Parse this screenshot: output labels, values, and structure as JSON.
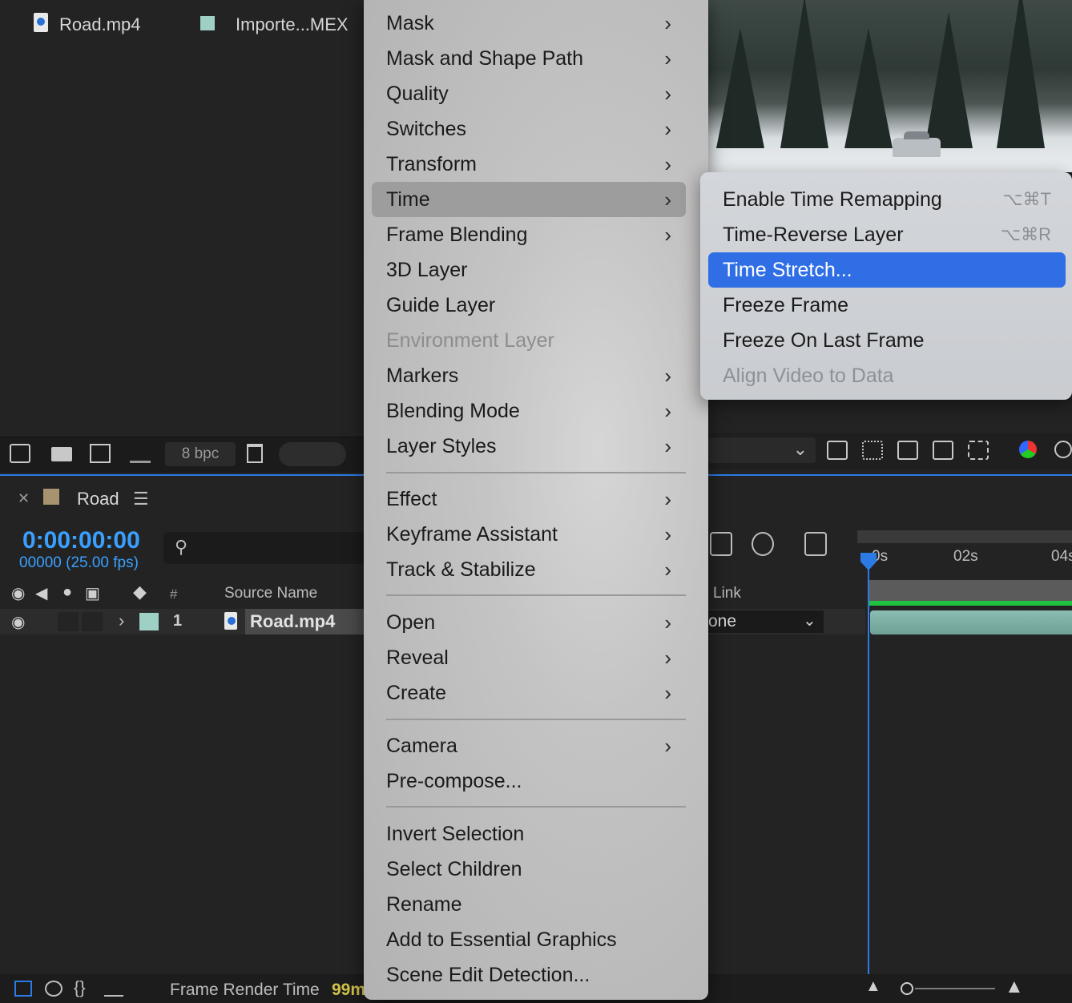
{
  "project": {
    "file_name": "Road.mp4",
    "file_type": "Importe...MEX",
    "bpc": "8 bpc",
    "label_color": "#9fd0c6"
  },
  "context_menu": {
    "items": [
      {
        "label": "Mask",
        "submenu": true
      },
      {
        "label": "Mask and Shape Path",
        "submenu": true
      },
      {
        "label": "Quality",
        "submenu": true
      },
      {
        "label": "Switches",
        "submenu": true
      },
      {
        "label": "Transform",
        "submenu": true
      },
      {
        "label": "Time",
        "submenu": true,
        "active": true
      },
      {
        "label": "Frame Blending",
        "submenu": true
      },
      {
        "label": "3D Layer",
        "submenu": false
      },
      {
        "label": "Guide Layer",
        "submenu": false
      },
      {
        "label": "Environment Layer",
        "submenu": false,
        "disabled": true
      },
      {
        "label": "Markers",
        "submenu": true
      },
      {
        "label": "Blending Mode",
        "submenu": true
      },
      {
        "label": "Layer Styles",
        "submenu": true
      },
      {
        "label": "Effect",
        "submenu": true
      },
      {
        "label": "Keyframe Assistant",
        "submenu": true
      },
      {
        "label": "Track & Stabilize",
        "submenu": true
      },
      {
        "label": "Open",
        "submenu": true
      },
      {
        "label": "Reveal",
        "submenu": true
      },
      {
        "label": "Create",
        "submenu": true
      },
      {
        "label": "Camera",
        "submenu": true
      },
      {
        "label": "Pre-compose...",
        "submenu": false
      },
      {
        "label": "Invert Selection",
        "submenu": false
      },
      {
        "label": "Select Children",
        "submenu": false
      },
      {
        "label": "Rename",
        "submenu": false
      },
      {
        "label": "Add to Essential Graphics",
        "submenu": false
      },
      {
        "label": "Scene Edit Detection...",
        "submenu": false
      }
    ]
  },
  "time_submenu": {
    "items": [
      {
        "label": "Enable Time Remapping",
        "shortcut": "⌥⌘T"
      },
      {
        "label": "Time-Reverse Layer",
        "shortcut": "⌥⌘R"
      },
      {
        "label": "Time Stretch...",
        "shortcut": "",
        "selected": true
      },
      {
        "label": "Freeze Frame",
        "shortcut": ""
      },
      {
        "label": "Freeze On Last Frame",
        "shortcut": ""
      },
      {
        "label": "Align Video to Data",
        "shortcut": "",
        "disabled": true
      }
    ]
  },
  "timeline": {
    "comp_name": "Road",
    "timecode": "0:00:00:00",
    "frame_fps": "00000 (25.00 fps)",
    "columns": {
      "number": "#",
      "source_name": "Source Name",
      "parent_link": "Link"
    },
    "layer": {
      "number": "1",
      "name": "Road.mp4",
      "parent": "one"
    },
    "ruler": {
      "t0": "0s",
      "t2": "02s",
      "t4": "04s"
    },
    "status_label": "Frame Render Time",
    "status_value": "99m",
    "comp_color": "#a89370",
    "accent": "#2c7be5"
  }
}
